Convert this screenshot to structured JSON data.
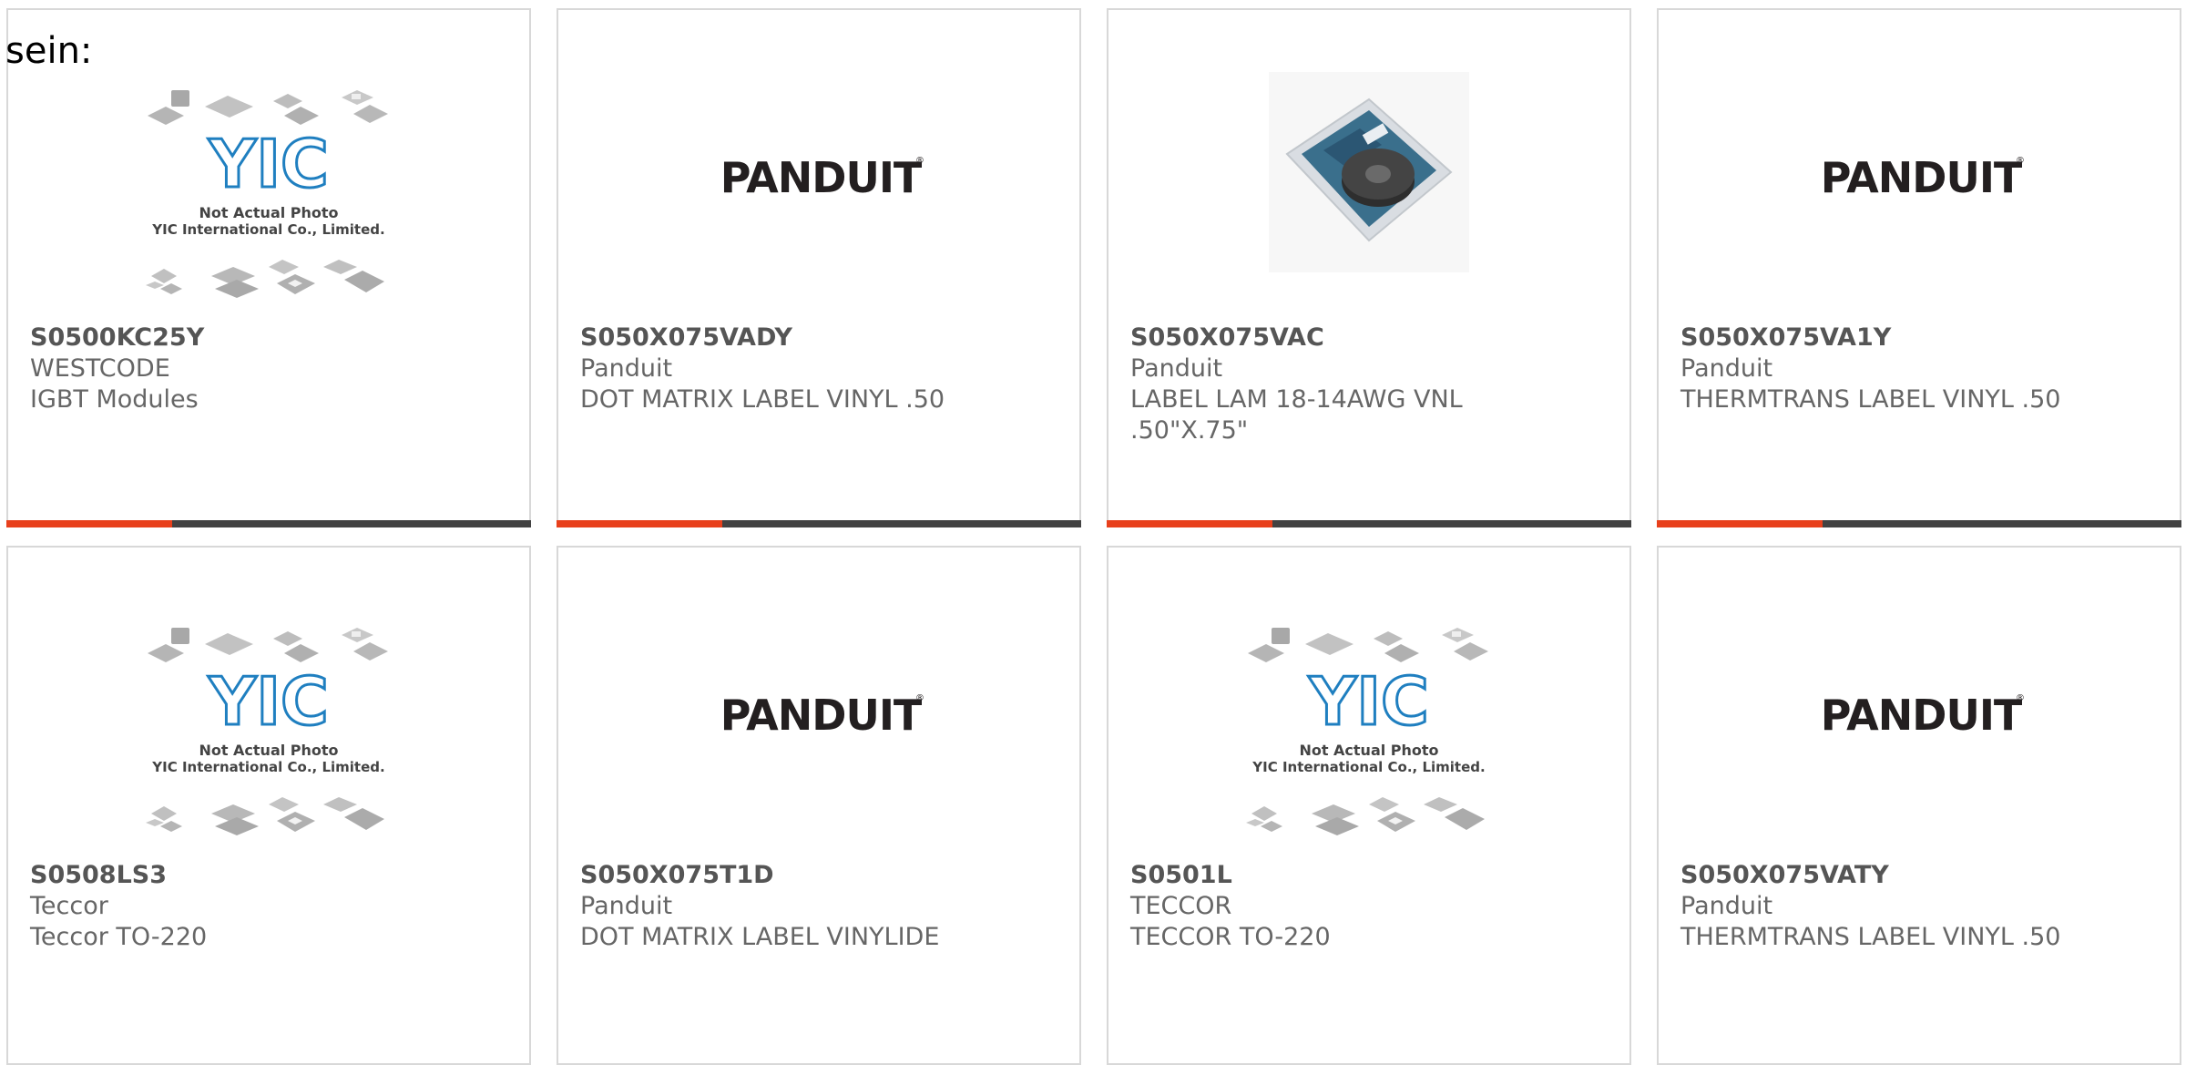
{
  "page": {
    "prefix_text": "sein:"
  },
  "placeholder": {
    "line1": "Not Actual Photo",
    "line2": "YIC International Co., Limited."
  },
  "colors": {
    "accent": "#e8401c",
    "bar_dark": "#424242",
    "border": "#d8d8d8",
    "text": "#666666",
    "yic_blue": "#1f7fc0"
  },
  "products": [
    {
      "part_number": "S0500KC25Y",
      "manufacturer": "WESTCODE",
      "description": "IGBT Modules",
      "image": "yic-placeholder-icon"
    },
    {
      "part_number": "S050X075VADY",
      "manufacturer": "Panduit",
      "description": "DOT MATRIX LABEL VINYL .50",
      "image": "panduit-logo"
    },
    {
      "part_number": "S050X075VAC",
      "manufacturer": "Panduit",
      "description": "LABEL LAM 18-14AWG VNL .50\"X.75\"",
      "image": "label-cartridge-photo"
    },
    {
      "part_number": "S050X075VA1Y",
      "manufacturer": "Panduit",
      "description": "THERMTRANS LABEL VINYL .50",
      "image": "panduit-logo"
    },
    {
      "part_number": "S0508LS3",
      "manufacturer": "Teccor",
      "description": "Teccor TO-220",
      "image": "yic-placeholder-icon"
    },
    {
      "part_number": "S050X075T1D",
      "manufacturer": "Panduit",
      "description": "DOT MATRIX LABEL VINYLIDE",
      "image": "panduit-logo"
    },
    {
      "part_number": "S0501L",
      "manufacturer": "TECCOR",
      "description": "TECCOR TO-220",
      "image": "yic-placeholder-icon"
    },
    {
      "part_number": "S050X075VATY",
      "manufacturer": "Panduit",
      "description": "THERMTRANS LABEL VINYL .50",
      "image": "panduit-logo"
    }
  ]
}
